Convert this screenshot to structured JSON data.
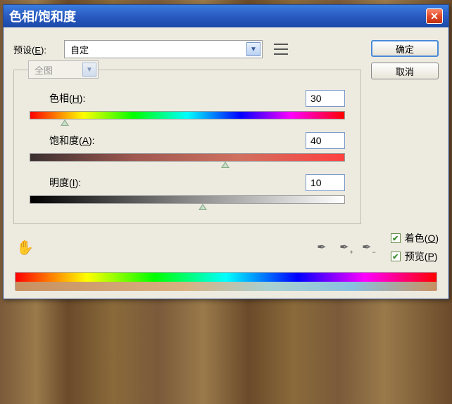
{
  "titlebar": {
    "title": "色相/饱和度"
  },
  "preset": {
    "label_pre": "预设(",
    "label_key": "E",
    "label_post": "):",
    "value": "自定"
  },
  "buttons": {
    "ok": "确定",
    "cancel": "取消"
  },
  "range": {
    "value": "全图"
  },
  "sliders": {
    "hue": {
      "label_pre": "色相(",
      "label_key": "H",
      "label_post": "):",
      "value": "30",
      "pos_pct": 11
    },
    "sat": {
      "label_pre": "饱和度(",
      "label_key": "A",
      "label_post": "):",
      "value": "40",
      "pos_pct": 62
    },
    "light": {
      "label_pre": "明度(",
      "label_key": "I",
      "label_post": "):",
      "value": "10",
      "pos_pct": 55
    }
  },
  "checks": {
    "colorize": {
      "label_pre": "着色(",
      "label_key": "O",
      "label_post": ")",
      "checked": true
    },
    "preview": {
      "label_pre": "预览(",
      "label_key": "P",
      "label_post": ")",
      "checked": true
    }
  }
}
